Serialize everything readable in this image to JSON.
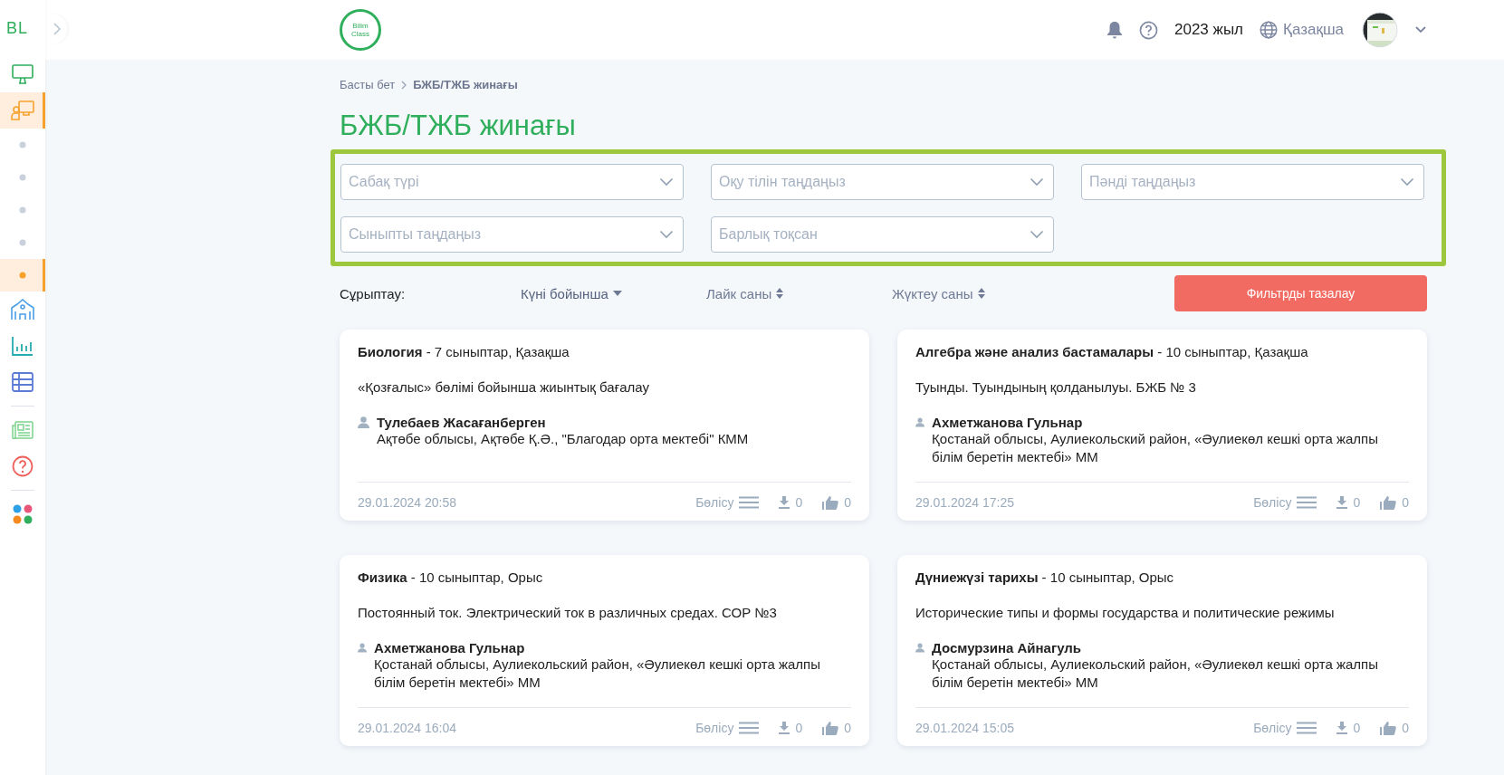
{
  "sidebar": {
    "logo": "BL",
    "items": [
      {
        "kind": "monitor",
        "selected": false
      },
      {
        "kind": "classroom",
        "selected": true
      },
      {
        "kind": "dot",
        "selected": false
      },
      {
        "kind": "dot",
        "selected": false
      },
      {
        "kind": "dot",
        "selected": false
      },
      {
        "kind": "dot",
        "selected": false
      },
      {
        "kind": "dot",
        "selected": true
      },
      {
        "kind": "school",
        "selected": false
      },
      {
        "kind": "chart",
        "selected": false
      },
      {
        "kind": "table",
        "selected": false
      },
      {
        "kind": "divider"
      },
      {
        "kind": "news",
        "selected": false
      },
      {
        "kind": "help",
        "selected": false
      },
      {
        "kind": "divider"
      },
      {
        "kind": "apps",
        "selected": false
      }
    ]
  },
  "header": {
    "logo_lines": [
      "Bilim",
      "Class"
    ],
    "year": "2023 жыл",
    "language": "Қазақша"
  },
  "breadcrumb": [
    "Басты бет",
    "БЖБ/ТЖБ жинағы"
  ],
  "title": "БЖБ/ТЖБ жинағы",
  "filters": [
    {
      "placeholder": "Сабақ түрі"
    },
    {
      "placeholder": "Оқу тілін таңдаңыз"
    },
    {
      "placeholder": "Пәнді таңдаңыз"
    },
    {
      "placeholder": "Сыныпты таңдаңыз"
    },
    {
      "placeholder": "Барлық тоқсан"
    }
  ],
  "sort": {
    "label": "Сұрыптау:",
    "options": [
      {
        "label": "Күні бойынша",
        "selected": true
      },
      {
        "label": "Лайк саны",
        "selected": false
      },
      {
        "label": "Жүктеу саны",
        "selected": false
      }
    ],
    "clear_button": "Фильтрды тазалау"
  },
  "cards": [
    {
      "subject": "**Биология** - 7 сыныптар, Қазақша",
      "description": "«Қозғалыс» бөлімі бойынша жиынтық бағалау",
      "author": "Тулебаев Жасағанберген",
      "school": "Ақтөбе облысы, Ақтөбе Қ.Ә., \"Благодар орта мектебі\" КММ",
      "date": "29.01.2024 20:58",
      "share": "Бөлісу",
      "downloads": "0",
      "likes": "0"
    },
    {
      "subject": "**Алгебра және анализ бастамалары** - 10 сыныптар, Қазақша",
      "description": "Туынды. Туындының қолданылуы. БЖБ № 3",
      "author": "Ахметжанова Гульнар",
      "school": "Қостанай облысы, Аулиекольский район, «Әулиекөл кешкі орта жалпы білім беретін мектебі» ММ",
      "date": "29.01.2024 17:25",
      "share": "Бөлісу",
      "downloads": "0",
      "likes": "0"
    },
    {
      "subject": "**Физика** - 10 сыныптар, Орыс",
      "description": "Постоянный ток. Электрический ток в различных средах. СОР №3",
      "author": "Ахметжанова Гульнар",
      "school": "Қостанай облысы, Аулиекольский район, «Әулиекөл кешкі орта жалпы білім беретін мектебі» ММ",
      "date": "29.01.2024 16:04",
      "share": "Бөлісу",
      "downloads": "0",
      "likes": "0"
    },
    {
      "subject": "**Дүниежүзі тарихы** - 10 сыныптар, Орыс",
      "description": "Исторические типы и формы государства и политические режимы",
      "author": "Досмурзина Айнагуль",
      "school": "Қостанай облысы, Аулиекольский район, «Әулиекөл кешкі орта жалпы білім беретін мектебі» ММ",
      "date": "29.01.2024 15:05",
      "share": "Бөлісу",
      "downloads": "0",
      "likes": "0"
    }
  ]
}
